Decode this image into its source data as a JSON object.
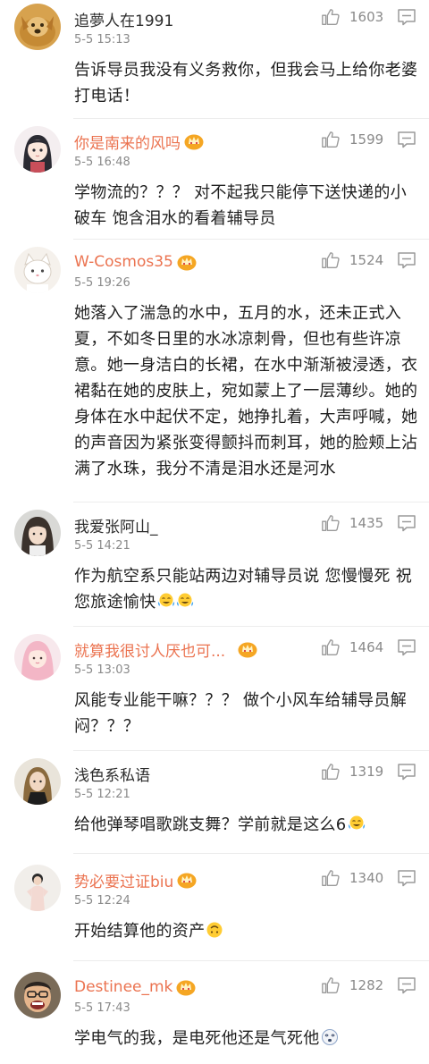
{
  "comments": [
    {
      "username": "追夢人在1991",
      "time": "5-5 15:13",
      "likes": "1603",
      "text": "告诉导员我没有义务救你，但我会马上给你老婆打电话！",
      "vip": false
    },
    {
      "username": "你是南来的风吗",
      "time": "5-5 16:48",
      "likes": "1599",
      "text": "学物流的？？？ 对不起我只能停下送快递的小破车 饱含泪水的看着辅导员",
      "vip": true
    },
    {
      "username": "W-Cosmos35",
      "time": "5-5 19:26",
      "likes": "1524",
      "text": "她落入了湍急的水中，五月的水，还未正式入夏，不如冬日里的水冰凉刺骨，但也有些许凉意。她一身洁白的长裙，在水中渐渐被浸透，衣裙黏在她的皮肤上，宛如蒙上了一层薄纱。她的身体在水中起伏不定，她挣扎着，大声呼喊，她的声音因为紧张变得颤抖而刺耳，她的脸颊上沾满了水珠，我分不清是泪水还是河水",
      "vip": true
    },
    {
      "username": "我爱张阿山_",
      "time": "5-5 14:21",
      "likes": "1435",
      "text": "作为航空系只能站两边对辅导员说 您慢慢死 祝您旅途愉快",
      "vip": false,
      "emojis": [
        "laugh-cry-emoji",
        "laugh-cry-emoji"
      ]
    },
    {
      "username": "就算我很讨人厌也可...",
      "time": "5-5 13:03",
      "likes": "1464",
      "text": "风能专业能干嘛？？？ 做个小风车给辅导员解闷？？？",
      "vip": true
    },
    {
      "username": "浅色系私语",
      "time": "5-5 12:21",
      "likes": "1319",
      "text": "给他弹琴唱歌跳支舞？学前就是这么6",
      "vip": false,
      "emojis": [
        "laugh-cry-emoji"
      ]
    },
    {
      "username": "势必要过证biu",
      "time": "5-5 12:24",
      "likes": "1340",
      "text": "开始结算他的资产",
      "vip": true,
      "emojis": [
        "upside-down-emoji"
      ]
    },
    {
      "username": "Destinee_mk",
      "time": "5-5 17:43",
      "likes": "1282",
      "text": "学电气的我，是电死他还是气死他",
      "vip": true,
      "emojis": [
        "dizzy-emoji"
      ]
    }
  ],
  "colors": {
    "vip_name": "#eb7350",
    "normal_name": "#2d2d2d",
    "meta": "#8a8a8a",
    "text": "#1f1f1f",
    "crown_badge": "#f5a623"
  }
}
